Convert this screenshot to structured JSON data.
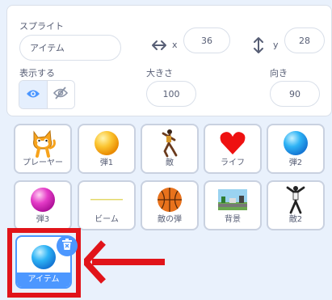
{
  "info": {
    "sprite_label": "スプライト",
    "sprite_name": "アイテム",
    "x_label": "x",
    "x_value": "36",
    "y_label": "y",
    "y_value": "28",
    "show_label": "表示する",
    "size_label": "大きさ",
    "size_value": "100",
    "direction_label": "向き",
    "direction_value": "90"
  },
  "sprites": [
    {
      "name": "プレーヤー",
      "icon": "cat-icon"
    },
    {
      "name": "弾1",
      "icon": "orange-ball-icon"
    },
    {
      "name": "敵",
      "icon": "dancer-icon"
    },
    {
      "name": "ライフ",
      "icon": "heart-icon"
    },
    {
      "name": "弾2",
      "icon": "blue-ball-icon"
    },
    {
      "name": "弾3",
      "icon": "pink-ball-icon"
    },
    {
      "name": "ビーム",
      "icon": "beam-line-icon"
    },
    {
      "name": "敵の弾",
      "icon": "basketball-icon"
    },
    {
      "name": "背景",
      "icon": "landscape-icon"
    },
    {
      "name": "敵2",
      "icon": "dancer-icon"
    }
  ],
  "selected_sprite": {
    "name": "アイテム",
    "icon": "blue-ball-icon"
  },
  "colors": {
    "accent": "#4c97ff",
    "highlight": "#e1141a",
    "pane_bg": "#e9f1fc"
  }
}
